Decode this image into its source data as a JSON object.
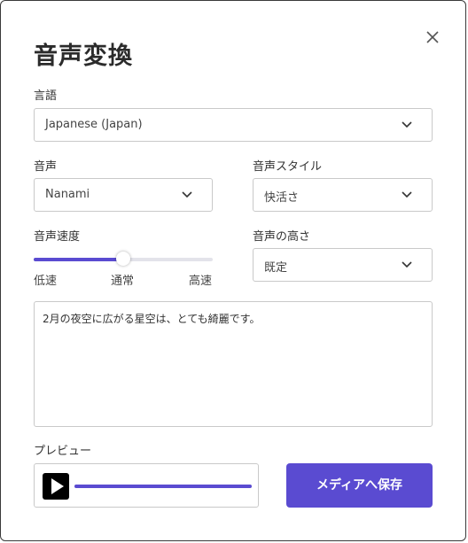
{
  "dialog": {
    "title": "音声変換",
    "close_icon": "close-icon"
  },
  "language": {
    "label": "言語",
    "selected": "Japanese (Japan)"
  },
  "voice": {
    "label": "音声",
    "selected": "Nanami"
  },
  "voice_style": {
    "label": "音声スタイル",
    "selected": "快活さ"
  },
  "speed": {
    "label": "音声速度",
    "min_label": "低速",
    "mid_label": "通常",
    "max_label": "高速",
    "value_percent": 50
  },
  "pitch": {
    "label": "音声の高さ",
    "selected": "既定"
  },
  "text_input": {
    "value": "2月の夜空に広がる星空は、とても綺麗です。"
  },
  "preview": {
    "label": "プレビュー",
    "play_icon": "play-icon",
    "progress_percent": 100
  },
  "save_button": {
    "label": "メディアへ保存"
  },
  "colors": {
    "accent": "#5a4bd1",
    "track": "#e3e3ea",
    "border": "#c9c9c9"
  }
}
